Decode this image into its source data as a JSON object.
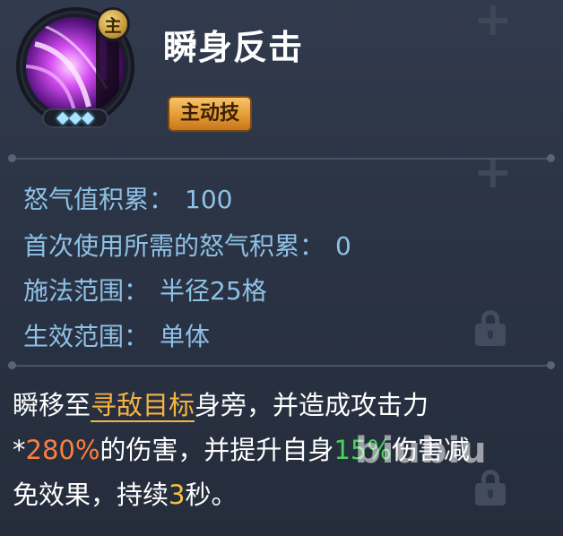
{
  "skill": {
    "name": "瞬身反击",
    "type_label": "主动技",
    "type_badge": "主",
    "star_count": 3
  },
  "stats": [
    {
      "label": "怒气值积累：",
      "value": "100"
    },
    {
      "label": "首次使用所需的怒气积累：",
      "value": "0"
    },
    {
      "label": "施法范围：",
      "value": "半径25格"
    },
    {
      "label": "生效范围：",
      "value": "单体"
    }
  ],
  "description": {
    "part1": "瞬移至",
    "target_link": "寻敌目标",
    "part2": "身旁，并造成攻击力",
    "part3": "*",
    "damage_pct": "280%",
    "part4": "的伤害，并提升自身",
    "reduction_pct": "15%",
    "part5": "伤害减免效果，持续",
    "duration": "3",
    "part6": "秒。"
  },
  "watermark": "biubiu",
  "colors": {
    "stat_text": "#8ec1e6",
    "link_orange": "#f5b342",
    "damage_red": "#ff7e3d",
    "buff_green": "#46d35a",
    "type_gold": "#e39b34"
  }
}
